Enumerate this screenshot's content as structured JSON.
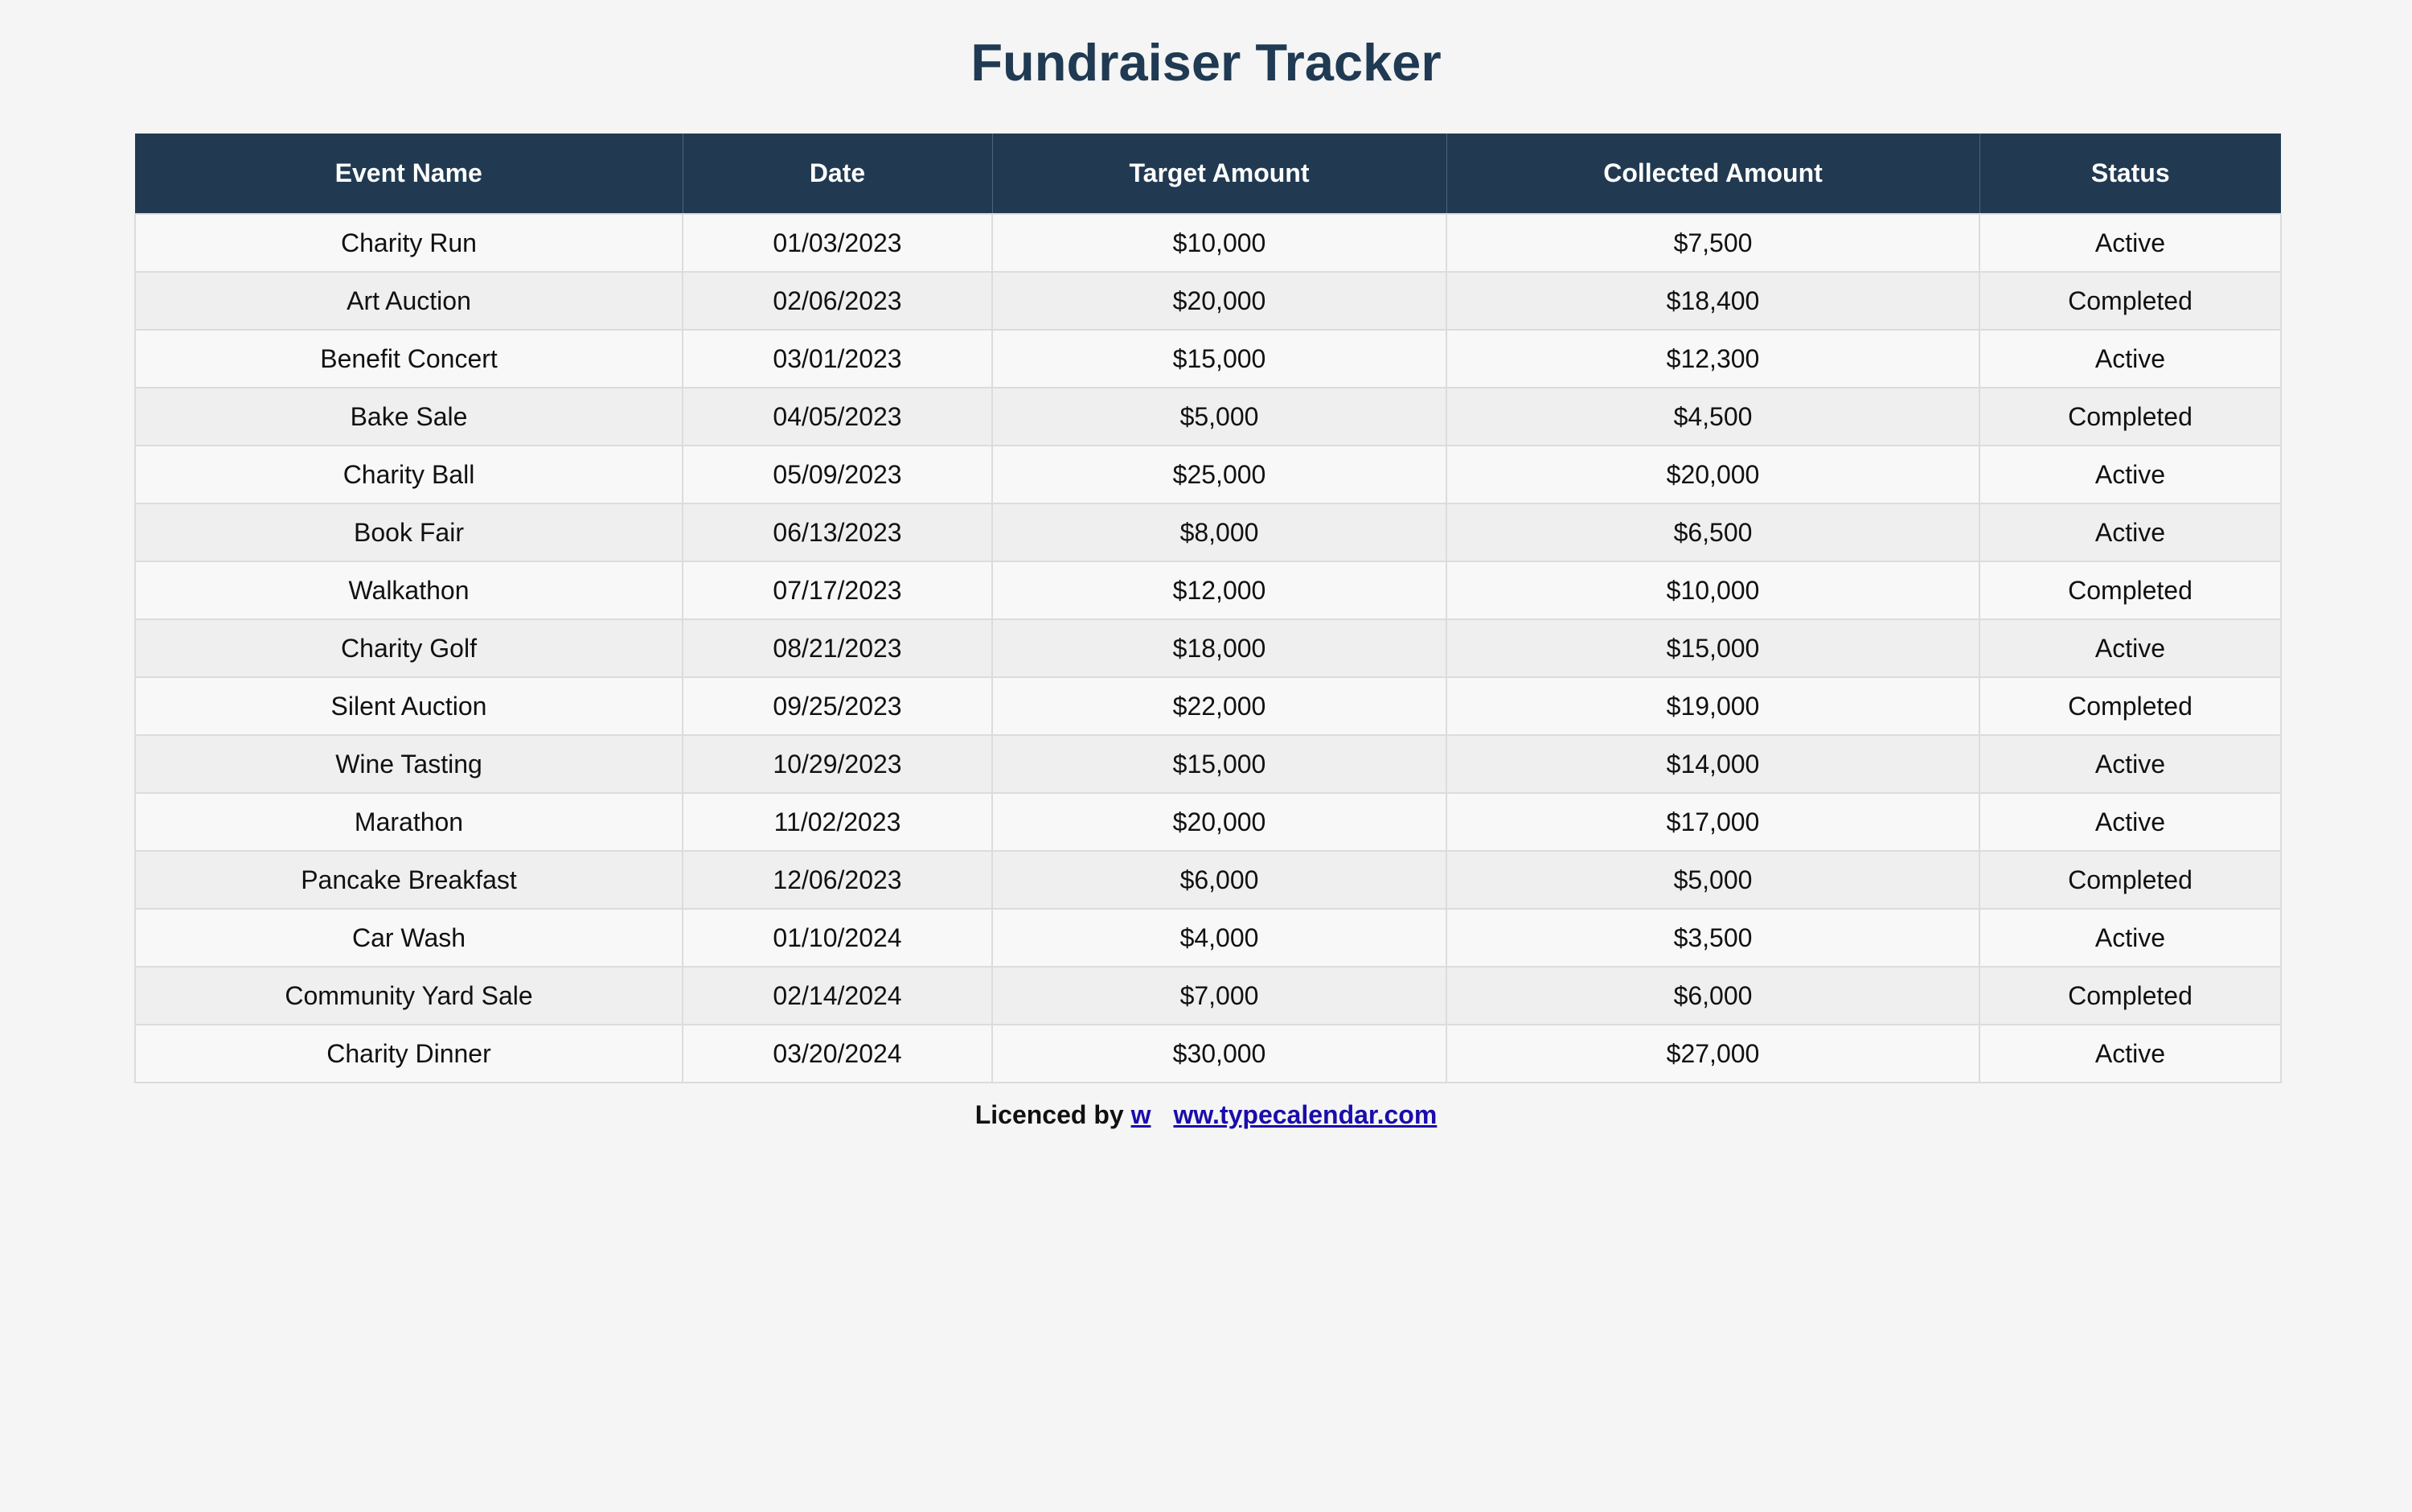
{
  "title": "Fundraiser Tracker",
  "table": {
    "headers": [
      "Event Name",
      "Date",
      "Target Amount",
      "Collected Amount",
      "Status"
    ],
    "rows": [
      [
        "Charity Run",
        "01/03/2023",
        "$10,000",
        "$7,500",
        "Active"
      ],
      [
        "Art Auction",
        "02/06/2023",
        "$20,000",
        "$18,400",
        "Completed"
      ],
      [
        "Benefit Concert",
        "03/01/2023",
        "$15,000",
        "$12,300",
        "Active"
      ],
      [
        "Bake Sale",
        "04/05/2023",
        "$5,000",
        "$4,500",
        "Completed"
      ],
      [
        "Charity Ball",
        "05/09/2023",
        "$25,000",
        "$20,000",
        "Active"
      ],
      [
        "Book Fair",
        "06/13/2023",
        "$8,000",
        "$6,500",
        "Active"
      ],
      [
        "Walkathon",
        "07/17/2023",
        "$12,000",
        "$10,000",
        "Completed"
      ],
      [
        "Charity Golf",
        "08/21/2023",
        "$18,000",
        "$15,000",
        "Active"
      ],
      [
        "Silent Auction",
        "09/25/2023",
        "$22,000",
        "$19,000",
        "Completed"
      ],
      [
        "Wine Tasting",
        "10/29/2023",
        "$15,000",
        "$14,000",
        "Active"
      ],
      [
        "Marathon",
        "11/02/2023",
        "$20,000",
        "$17,000",
        "Active"
      ],
      [
        "Pancake Breakfast",
        "12/06/2023",
        "$6,000",
        "$5,000",
        "Completed"
      ],
      [
        "Car Wash",
        "01/10/2024",
        "$4,000",
        "$3,500",
        "Active"
      ],
      [
        "Community Yard Sale",
        "02/14/2024",
        "$7,000",
        "$6,000",
        "Completed"
      ],
      [
        "Charity Dinner",
        "03/20/2024",
        "$30,000",
        "$27,000",
        "Active"
      ]
    ]
  },
  "footer": {
    "prefix": "Licenced by",
    "link_part1": "w",
    "link_part2": "ww.typecalendar.com"
  },
  "colors": {
    "header_bg": "#213a51",
    "title": "#1f3a52",
    "link": "#1a0dab"
  }
}
